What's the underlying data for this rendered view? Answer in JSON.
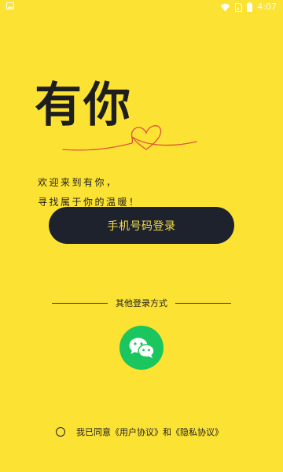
{
  "status_bar": {
    "time": "4:07",
    "icons": [
      "image-notification-icon",
      "wifi-icon",
      "sim-icon",
      "battery-icon"
    ]
  },
  "logo": {
    "text": "有你",
    "decoration_icon": "heart-line-icon"
  },
  "welcome": {
    "line1": "欢迎来到有你，",
    "line2": "寻找属于你的温暖！"
  },
  "login_button": {
    "label": "手机号码登录"
  },
  "other_login": {
    "label": "其他登录方式",
    "wechat_icon": "wechat-icon"
  },
  "agreement": {
    "prefix": "我已同意",
    "user_agreement": "《用户协议》",
    "conjunction": "和",
    "privacy_agreement": "《隐私协议》",
    "checked": false
  },
  "colors": {
    "background": "#FCE233",
    "button_bg": "#1E222C",
    "button_text": "#F3DB4B",
    "wechat_green": "#1AC65D",
    "heart_accent": "#E0543A"
  }
}
